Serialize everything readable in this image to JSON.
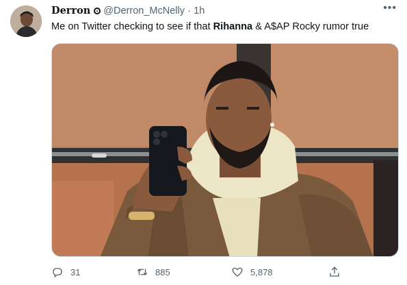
{
  "tweet": {
    "author": {
      "display_name": "Derron",
      "handle": "@Derron_McNelly",
      "separator": "·",
      "time": "1h"
    },
    "text": {
      "part1": "Me on Twitter checking to see if that ",
      "bold1": "Rihanna",
      "part2": " & A$AP Rocky rumor true"
    },
    "media": {
      "type": "photo"
    },
    "actions": {
      "replies": "31",
      "retweets": "885",
      "likes": "5,878"
    },
    "icons": [
      "more-icon",
      "reply-icon",
      "retweet-icon",
      "like-icon",
      "share-icon",
      "verified-badge-icon"
    ]
  }
}
